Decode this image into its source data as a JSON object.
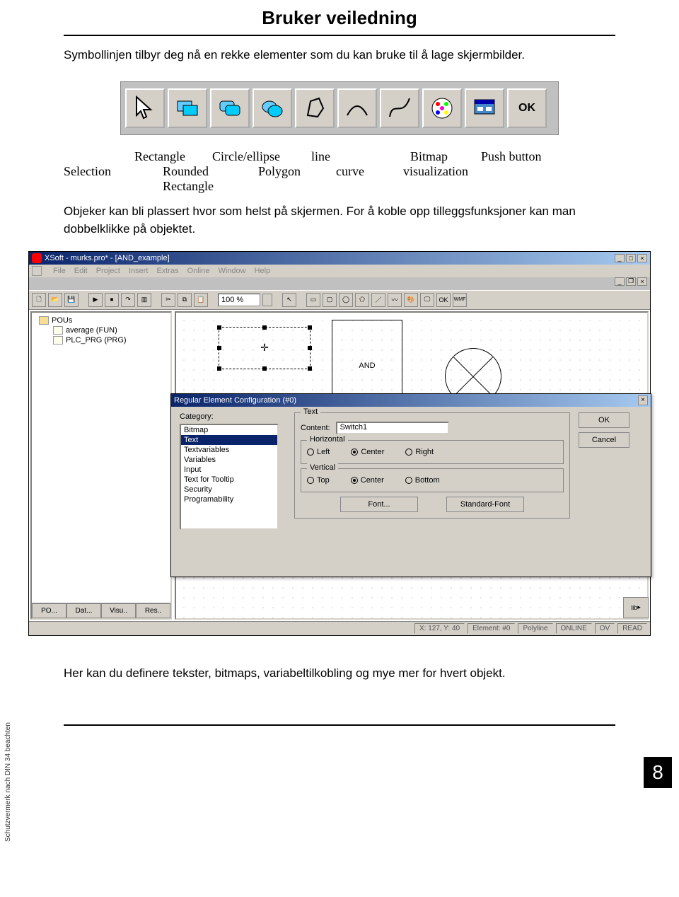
{
  "header": {
    "title": "Bruker veiledning"
  },
  "intro": "Symbollinjen tilbyr deg nå en rekke elementer som du kan bruke til å lage skjermbilder.",
  "toolbar_figure": {
    "icons": [
      "selection",
      "rectangle",
      "rounded-rectangle",
      "circle-ellipse",
      "polygon",
      "line",
      "curve",
      "bitmap",
      "visualization",
      "ok"
    ]
  },
  "toolbar_labels": {
    "row1": {
      "selection": "Selection",
      "rectangle": "Rectangle",
      "circle": "Circle/ellipse",
      "line": "line",
      "bitmap": "Bitmap",
      "push": "Push button"
    },
    "row2": {
      "rounded": "Rounded Rectangle",
      "polygon": "Polygon",
      "curve": "curve",
      "vis": "visualization"
    }
  },
  "obj_text": "Objeker kan bli plassert hvor som helst på skjermen. For å koble opp tilleggsfunksjoner kan man dobbelklikke på objektet.",
  "app": {
    "title": "XSoft - murks.pro* - [AND_example]",
    "menus": [
      "File",
      "Edit",
      "Project",
      "Insert",
      "Extras",
      "Online",
      "Window",
      "Help"
    ],
    "zoom": "100 %",
    "tree": {
      "root": "POUs",
      "items": [
        {
          "label": "average (FUN)"
        },
        {
          "label": "PLC_PRG (PRG)"
        }
      ]
    },
    "panel_tabs": [
      "PO...",
      "Dat...",
      "Visu..",
      "Res.."
    ],
    "canvas": {
      "and_label": "AND"
    },
    "scroll_label": "lib",
    "status": {
      "xy": "X:   127, Y:     40",
      "element": "Element: #0",
      "polyline": "Polyline",
      "online": "ONLINE",
      "ov": "OV",
      "read": "READ"
    }
  },
  "dialog": {
    "title": "Regular Element Configuration (#0)",
    "category_label": "Category:",
    "categories": [
      "Bitmap",
      "Text",
      "Textvariables",
      "Variables",
      "Input",
      "Text for Tooltip",
      "Security",
      "Programability"
    ],
    "selected_category": "Text",
    "text_group": {
      "legend": "Text",
      "content_label": "Content:",
      "content_value": "Switch1"
    },
    "horizontal": {
      "legend": "Horizontal",
      "options": [
        "Left",
        "Center",
        "Right"
      ],
      "selected": "Center"
    },
    "vertical": {
      "legend": "Vertical",
      "options": [
        "Top",
        "Center",
        "Bottom"
      ],
      "selected": "Center"
    },
    "buttons": {
      "ok": "OK",
      "cancel": "Cancel",
      "font": "Font...",
      "stdfont": "Standard-Font"
    }
  },
  "bottom_text": "Her kan du definere tekster, bitmaps, variabeltilkobling og mye mer for hvert objekt.",
  "page_number": "8",
  "side_note": "Schutzvermerk nach DIN 34 beachten"
}
